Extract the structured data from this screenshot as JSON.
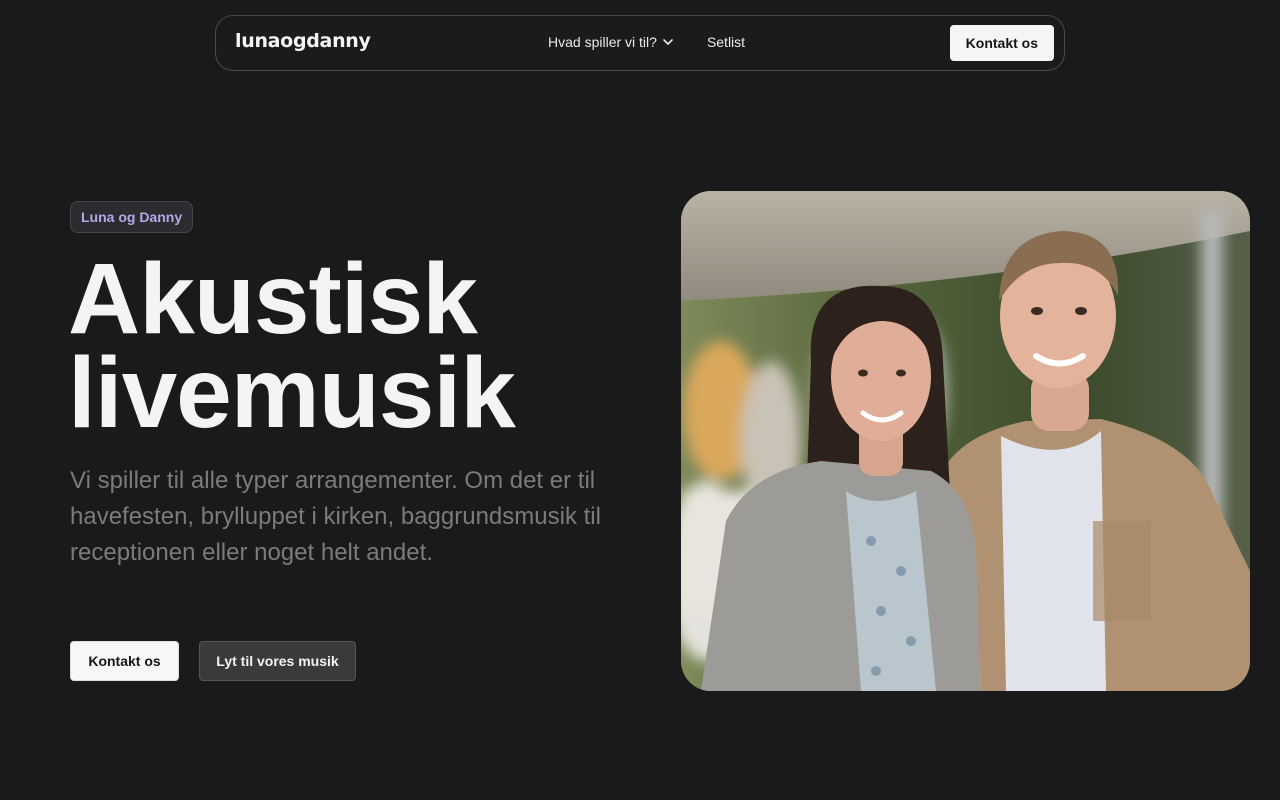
{
  "nav": {
    "logo": "lunaogdanny",
    "dropdown_label": "Hvad spiller vi til?",
    "link_setlist": "Setlist",
    "cta_label": "Kontakt os"
  },
  "hero": {
    "badge": "Luna og Danny",
    "title_line1": "Akustisk",
    "title_line2": "livemusik",
    "subtitle": "Vi spiller til alle typer arrangementer. Om det er til havefesten, brylluppet i kirken, baggrundsmusik til receptionen eller noget helt andet.",
    "primary_button": "Kontakt os",
    "secondary_button": "Lyt til vores musik"
  },
  "photo": {
    "subject": "portrait-photo"
  },
  "colors": {
    "background": "#1a1a1a",
    "badge_text": "#b6a7e8",
    "subtitle": "#7b7b7b"
  }
}
